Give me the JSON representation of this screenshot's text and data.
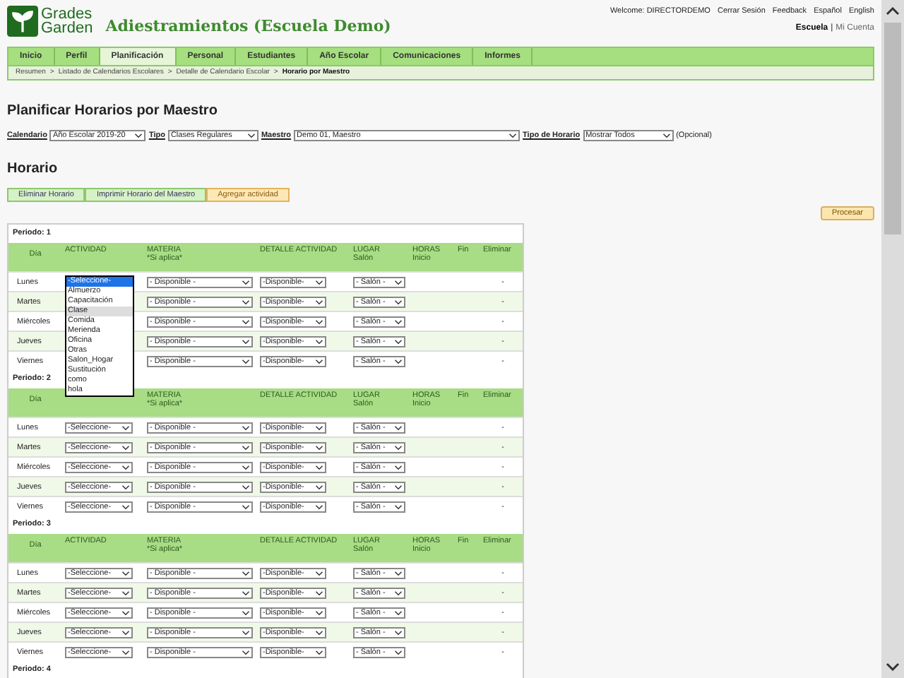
{
  "header": {
    "logo_line1": "Grades",
    "logo_line2": "Garden",
    "school": "Adiestramientos (Escuela Demo)",
    "links": [
      "Welcome: DIRECTORDEMO",
      "Cerrar Sesión",
      "Feedback",
      "Español",
      "English"
    ],
    "account": [
      {
        "label": "Escuela",
        "selected": true
      },
      {
        "label": "Mi Cuenta",
        "selected": false
      }
    ],
    "account_sep": "|"
  },
  "nav": {
    "tabs": [
      {
        "label": "Inicio",
        "selected": false
      },
      {
        "label": "Perfil",
        "selected": false
      },
      {
        "label": "Planificación",
        "selected": true
      },
      {
        "label": "Personal",
        "selected": false
      },
      {
        "label": "Estudiantes",
        "selected": false
      },
      {
        "label": "Año Escolar",
        "selected": false
      },
      {
        "label": "Comunicaciones",
        "selected": false
      },
      {
        "label": "Informes",
        "selected": false
      }
    ]
  },
  "breadcrumb": {
    "items": [
      "Resumen",
      "Listado de Calendarios Escolares",
      "Detalle de Calendario Escolar",
      "Horario por Maestro"
    ],
    "separator": ">"
  },
  "page_title": "Planificar Horarios por Maestro",
  "filters": [
    {
      "label": "Calendario",
      "value": "Año Escolar 2019-20"
    },
    {
      "label": "Tipo",
      "value": "Clases Regulares"
    },
    {
      "label": "Maestro",
      "value": "Demo 01, Maestro"
    },
    {
      "label": "Tipo de Horario",
      "value": "Mostrar Todos"
    }
  ],
  "filters_note": "(Opcional)",
  "section_title": "Horario",
  "actions": [
    {
      "label": "Eliminar Horario",
      "kind": "green"
    },
    {
      "label": "Imprimir Horario del Maestro",
      "kind": "green"
    },
    {
      "label": "Agregar actividad",
      "kind": "orange"
    }
  ],
  "process_button": "Procesar",
  "periods": [
    {
      "label": "Periodo: 1",
      "columns": [
        {
          "top": "Día"
        },
        {
          "top": "ACTIVIDAD"
        },
        {
          "top": "MATERIA",
          "sub": "*Si aplica*"
        },
        {
          "top": "DETALLE ACTIVIDAD"
        },
        {
          "top": "LUGAR",
          "sub": "Salón"
        },
        {
          "top": "HORAS",
          "sub": "Inicio"
        },
        {
          "sub": "Fin"
        },
        {
          "sub": "Eliminar"
        }
      ],
      "rows": [
        {
          "day": "Lunes",
          "materia": "- Disponible -",
          "detalle": "-Disponible-",
          "lugar": "- Salón -",
          "eliminar": "-"
        },
        {
          "day": "Martes",
          "materia": "- Disponible -",
          "detalle": "-Disponible-",
          "lugar": "- Salón -",
          "eliminar": "-"
        },
        {
          "day": "Miércoles",
          "materia": "- Disponible -",
          "detalle": "-Disponible-",
          "lugar": "- Salón -",
          "eliminar": "-"
        },
        {
          "day": "Jueves",
          "materia": "- Disponible -",
          "detalle": "-Disponible-",
          "lugar": "- Salón -",
          "eliminar": "-"
        },
        {
          "day": "Viernes",
          "materia": "- Disponible -",
          "detalle": "-Disponible-",
          "lugar": "- Salón -",
          "eliminar": "-"
        }
      ]
    },
    {
      "label": "Periodo: 2",
      "columns": [
        {
          "top": "Día"
        },
        {},
        {
          "top": "MATERIA",
          "sub": "*Si aplica*"
        },
        {
          "top": "DETALLE ACTIVIDAD"
        },
        {
          "top": "LUGAR",
          "sub": "Salón"
        },
        {
          "top": "HORAS",
          "sub": "Inicio"
        },
        {
          "sub": "Fin"
        },
        {
          "sub": "Eliminar"
        }
      ],
      "rows": [
        {
          "day": "Lunes",
          "actividad": "-Seleccione-",
          "materia": "- Disponible -",
          "detalle": "-Disponible-",
          "lugar": "- Salón -",
          "eliminar": "-"
        },
        {
          "day": "Martes",
          "actividad": "-Seleccione-",
          "materia": "- Disponible -",
          "detalle": "-Disponible-",
          "lugar": "- Salón -",
          "eliminar": "-"
        },
        {
          "day": "Miércoles",
          "actividad": "-Seleccione-",
          "materia": "- Disponible -",
          "detalle": "-Disponible-",
          "lugar": "- Salón -",
          "eliminar": "-"
        },
        {
          "day": "Jueves",
          "actividad": "-Seleccione-",
          "materia": "- Disponible -",
          "detalle": "-Disponible-",
          "lugar": "- Salón -",
          "eliminar": "-"
        },
        {
          "day": "Viernes",
          "actividad": "-Seleccione-",
          "materia": "- Disponible -",
          "detalle": "-Disponible-",
          "lugar": "- Salón -",
          "eliminar": "-"
        }
      ]
    },
    {
      "label": "Periodo: 3",
      "columns": [
        {
          "top": "Día"
        },
        {
          "top": "ACTIVIDAD"
        },
        {
          "top": "MATERIA",
          "sub": "*Si aplica*"
        },
        {
          "top": "DETALLE ACTIVIDAD"
        },
        {
          "top": "LUGAR",
          "sub": "Salón"
        },
        {
          "top": "HORAS",
          "sub": "Inicio"
        },
        {
          "sub": "Fin"
        },
        {
          "sub": "Eliminar"
        }
      ],
      "rows": [
        {
          "day": "Lunes",
          "actividad": "-Seleccione-",
          "materia": "- Disponible -",
          "detalle": "-Disponible-",
          "lugar": "- Salón -",
          "eliminar": "-"
        },
        {
          "day": "Martes",
          "actividad": "-Seleccione-",
          "materia": "- Disponible -",
          "detalle": "-Disponible-",
          "lugar": "- Salón -",
          "eliminar": "-"
        },
        {
          "day": "Miércoles",
          "actividad": "-Seleccione-",
          "materia": "- Disponible -",
          "detalle": "-Disponible-",
          "lugar": "- Salón -",
          "eliminar": "-"
        },
        {
          "day": "Jueves",
          "actividad": "-Seleccione-",
          "materia": "- Disponible -",
          "detalle": "-Disponible-",
          "lugar": "- Salón -",
          "eliminar": "-"
        },
        {
          "day": "Viernes",
          "actividad": "-Seleccione-",
          "materia": "- Disponible -",
          "detalle": "-Disponible-",
          "lugar": "- Salón -",
          "eliminar": "-"
        }
      ]
    },
    {
      "label": "Periodo: 4"
    }
  ],
  "open_dropdown": {
    "options": [
      {
        "label": "-Seleccione-",
        "selected": true,
        "hovered": false
      },
      {
        "label": "Almuerzo",
        "selected": false,
        "hovered": false
      },
      {
        "label": "Capacitación",
        "selected": false,
        "hovered": false
      },
      {
        "label": "Clase",
        "selected": false,
        "hovered": true
      },
      {
        "label": "Comida",
        "selected": false,
        "hovered": false
      },
      {
        "label": "Merienda",
        "selected": false,
        "hovered": false
      },
      {
        "label": "Oficina",
        "selected": false,
        "hovered": false
      },
      {
        "label": "Otras",
        "selected": false,
        "hovered": false
      },
      {
        "label": "Salon_Hogar",
        "selected": false,
        "hovered": false
      },
      {
        "label": "Sustitución",
        "selected": false,
        "hovered": false
      },
      {
        "label": "como",
        "selected": false,
        "hovered": false
      },
      {
        "label": "hola",
        "selected": false,
        "hovered": false
      }
    ]
  }
}
